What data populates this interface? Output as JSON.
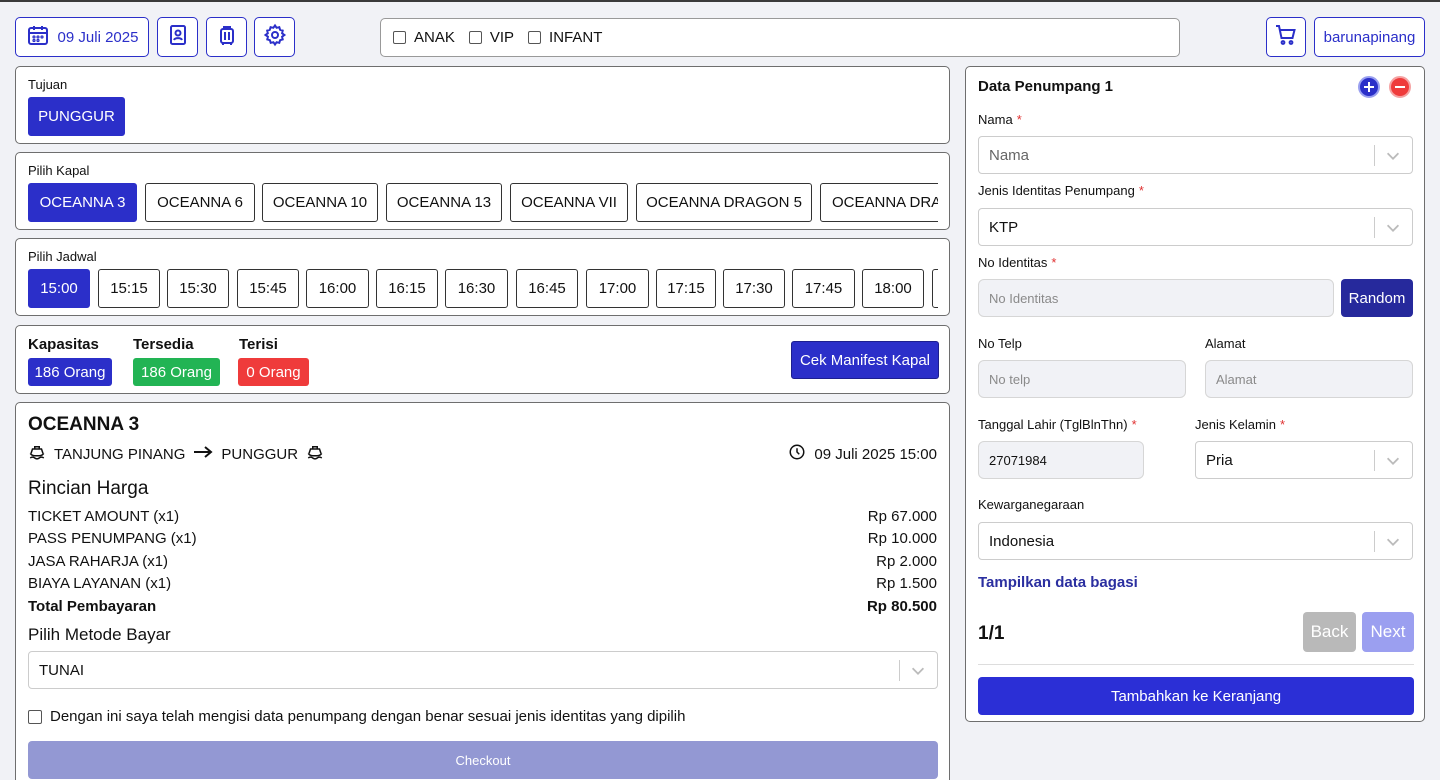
{
  "header": {
    "date": "09 Juli 2025",
    "filters": [
      "ANAK",
      "VIP",
      "INFANT"
    ],
    "username": "barunapinang"
  },
  "tujuan": {
    "label": "Tujuan",
    "selected": "PUNGGUR"
  },
  "kapal": {
    "label": "Pilih Kapal",
    "items": [
      "OCEANNA 3",
      "OCEANNA 6",
      "OCEANNA 10",
      "OCEANNA 13",
      "OCEANNA VII",
      "OCEANNA DRAGON 5",
      "OCEANNA DRA"
    ]
  },
  "jadwal": {
    "label": "Pilih Jadwal",
    "items": [
      "15:00",
      "15:15",
      "15:30",
      "15:45",
      "16:00",
      "16:15",
      "16:30",
      "16:45",
      "17:00",
      "17:15",
      "17:30",
      "17:45",
      "18:00"
    ]
  },
  "capacity": {
    "kapasitas_label": "Kapasitas",
    "kapasitas_value": "186 Orang",
    "tersedia_label": "Tersedia",
    "tersedia_value": "186 Orang",
    "terisi_label": "Terisi",
    "terisi_value": "0 Orang",
    "manifest_button": "Cek Manifest Kapal",
    "colors": {
      "primary": "#2b2fc9",
      "green": "#22b454",
      "red": "#ef3b3b"
    }
  },
  "trip": {
    "ship": "OCEANNA 3",
    "origin": "TANJUNG PINANG",
    "destination": "PUNGGUR",
    "datetime": "09 Juli 2025 15:00",
    "rincian_title": "Rincian Harga",
    "lines": [
      {
        "label": "TICKET AMOUNT (x1)",
        "amount": "Rp 67.000"
      },
      {
        "label": "PASS PENUMPANG (x1)",
        "amount": "Rp 10.000"
      },
      {
        "label": "JASA RAHARJA (x1)",
        "amount": "Rp 2.000"
      },
      {
        "label": "BIAYA LAYANAN (x1)",
        "amount": "Rp 1.500"
      }
    ],
    "total_label": "Total Pembayaran",
    "total_amount": "Rp 80.500",
    "payment_title": "Pilih Metode Bayar",
    "payment_value": "TUNAI",
    "agreement": "Dengan ini saya telah mengisi data penumpang dengan benar sesuai jenis identitas yang dipilih",
    "checkout": "Checkout"
  },
  "form": {
    "title": "Data Penumpang 1",
    "nama_label": "Nama",
    "nama_placeholder": "Nama",
    "jenis_id_label": "Jenis Identitas Penumpang",
    "jenis_id_value": "KTP",
    "no_id_label": "No Identitas",
    "no_id_placeholder": "No Identitas",
    "random": "Random",
    "telp_label": "No Telp",
    "telp_placeholder": "No telp",
    "alamat_label": "Alamat",
    "alamat_placeholder": "Alamat",
    "tgl_label": "Tanggal Lahir (TglBlnThn)",
    "tgl_value": "27071984",
    "kelamin_label": "Jenis Kelamin",
    "kelamin_value": "Pria",
    "warga_label": "Kewarganegaraan",
    "warga_value": "Indonesia",
    "bagasi_link": "Tampilkan data bagasi",
    "page": "1/1",
    "back": "Back",
    "next": "Next",
    "add_to_cart": "Tambahkan ke Keranjang"
  }
}
